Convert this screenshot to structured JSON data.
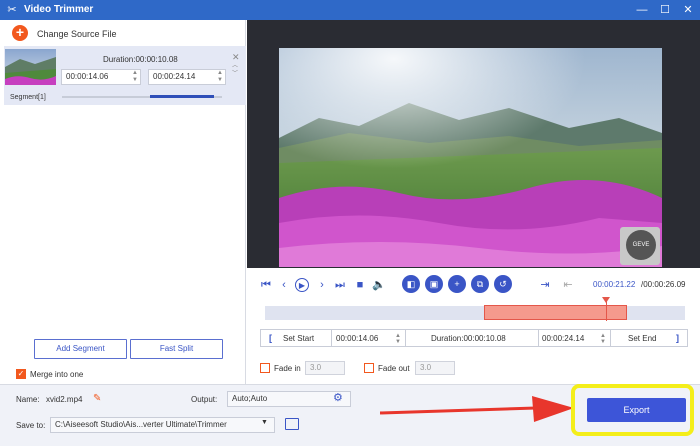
{
  "window": {
    "title": "Video Trimmer",
    "app_icon": "scissors-icon",
    "minimize": "—",
    "maximize": "☐",
    "close": "✕"
  },
  "source": {
    "change_label": "Change Source File"
  },
  "segment": {
    "duration": "Duration:00:00:10.08",
    "start": "00:00:14.06",
    "end": "00:00:24.14",
    "label": "Segment[1]"
  },
  "left_buttons": {
    "add_segment": "Add Segment",
    "fast_split": "Fast Split"
  },
  "merge": {
    "label": "Merge into one",
    "checked": true
  },
  "video": {
    "watermark": "GEVE"
  },
  "playback": {
    "current": "00:00:21.22",
    "total": "/00:00:26.09"
  },
  "trim": {
    "set_start": "Set Start",
    "start_time": "00:00:14.06",
    "duration": "Duration:00:00:10.08",
    "end_time": "00:00:24.14",
    "set_end": "Set End"
  },
  "fade": {
    "in_label": "Fade in",
    "in_value": "3.0",
    "out_label": "Fade out",
    "out_value": "3.0"
  },
  "output": {
    "name_label": "Name:",
    "name_value": "xvid2.mp4",
    "output_label": "Output:",
    "output_value": "Auto;Auto",
    "save_label": "Save to:",
    "save_path": "C:\\Aiseesoft Studio\\Ais...verter Ultimate\\Trimmer",
    "export_label": "Export"
  },
  "colors": {
    "accent": "#3d55d8",
    "highlight": "#f4ee1a",
    "arrow": "#e8362c",
    "titlebar": "#2f69c8"
  }
}
